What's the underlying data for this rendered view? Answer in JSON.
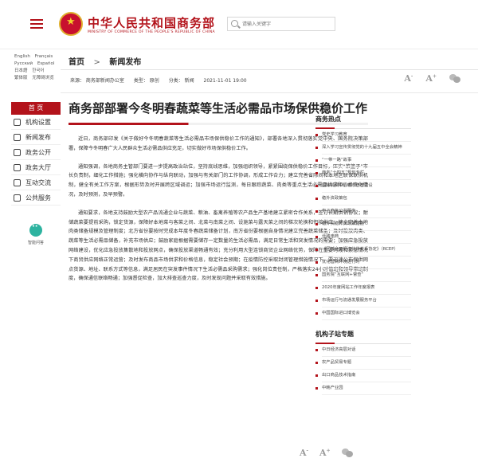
{
  "header": {
    "site_title": "中华人民共和国商务部",
    "site_subtitle": "MINISTRY OF COMMERCE OF THE PEOPLE'S REPUBLIC OF CHINA",
    "search_placeholder": "请输入关键字"
  },
  "languages": [
    "English",
    "Français",
    "Русский",
    "Español",
    "日本語",
    "한국어",
    "繁体版",
    "无障碍浏览"
  ],
  "sidebar": {
    "home": "首 页",
    "items": [
      {
        "label": "机构设置",
        "icon": "org-icon"
      },
      {
        "label": "新闻发布",
        "icon": "news-icon"
      },
      {
        "label": "政务公开",
        "icon": "gov-open-icon"
      },
      {
        "label": "政务大厅",
        "icon": "hall-icon"
      },
      {
        "label": "互动交流",
        "icon": "chat-icon"
      },
      {
        "label": "公共服务",
        "icon": "service-icon"
      }
    ],
    "qa_label": "智能问答"
  },
  "breadcrumb": {
    "home": "首页",
    "current": "新闻发布"
  },
  "meta": {
    "source": "来源：  商务部新闻办公室",
    "type": "类型：  原创",
    "category": "分类：  新闻",
    "date": "2021-11-01 19:00"
  },
  "article": {
    "title": "商务部部署今冬明春蔬菜等生活必需品市场保供稳价工作",
    "paragraphs": [
      "近日，商务部印发《关于做好今冬明春蔬菜等生活必需品市场保供稳价工作的通知》，部署各地深入贯彻落实党中央、国务院决策部署，保障今冬明春广大人民群众生活必需品供应充足，切实做好市场保供稳价工作。",
      "通知强调，各地商务主管部门要进一步提高政治站位，坚持底线思维，加强组织领导，紧紧围绕保供稳价工作目标，压实“菜篮子”市长负责制，细化工作措施；强化横向协作与纵向联动，加强与有关部门的工作协调，形成工作合力；建立完善省际间和本地区联保联供机制，健全有关工作方案，根据形势及时开展跨区域调运；加强市场运行监测，每日跟踪蔬菜、肉类等重点生活必需品供求和价格变化情况，及时预测，及早预警。",
      "通知要求，各地支持鼓励大型农产品流通企业与蔬菜、粮油、畜禽养殖等农产品生产基地建立紧密合作关系，签订长期供销协议；耐储蔬菜要提前采购，锁定货源，保障好本地菜与客菜之间、北菜与南菜之间、设施菜与露天菜之间的梯次轮换和衔接供应；健全完善本地肉类储备规模及管理制度；北方省份要按时完成本年度冬春蔬菜储备计划，南方省份要根据自身情况建立完善蔬菜储备；及时投放肉类、蔬菜等生活必需品储备，补充市场供应；鼓励家庭根据需要储存一定数量的生活必需品，满足日常生活和突发情况的需要；加强应急投放网络建设，优化应急投放集散地和投放网点，确保投放渠道畅通有效；充分利用大型连锁商贸企业网络优势，保障在重要时段和紧急情况下商贸供应网络正常运营；及时发布商品市场供求和价格信息，稳定社会预期；在疫情防控采取封闭管理措施情况下，要迅速公布保供网点货源、地址、联系方式等信息，满足居民在突发事件情况下生活必需品采购需求；强化岗位责任制，严格落实24小时值班和领导带班制度，确保通信联络畅通；加强督促检查，加大排查巡查力度，及时发现问题并采取有效措施。"
    ]
  },
  "right": {
    "hot_title": "商务热点",
    "hot_items": [
      "党史学习教育",
      "深入学习宣传贯彻党的十九届五中全会精神",
      "“一带一路”故事",
      "商务“十四五”规划专栏",
      "国际消费中心城市培育建设",
      "稳外资政策包",
      "电子商务公共服务",
      "稳外贸稳外资政策措施",
      "丝路电商",
      "《区域全面经济伙伴关系协定》（RCEP）",
      "优化营商环境进行时",
      "国务院“互联网+督查”",
      "2020年度网站工作年度报表",
      "市场运行与流通发展服务平台",
      "中国国际进口博览会"
    ],
    "feature_title": "机构子站专题",
    "feature_items": [
      "中日经济高层对话",
      "农产品贸易专题",
      "出口商品技术指南",
      "中韩产业园"
    ]
  },
  "icons": {
    "font_decrease": "A",
    "font_increase": "A"
  },
  "colors": {
    "brand_red": "#b3131b",
    "qa_teal": "#2db3a0"
  }
}
